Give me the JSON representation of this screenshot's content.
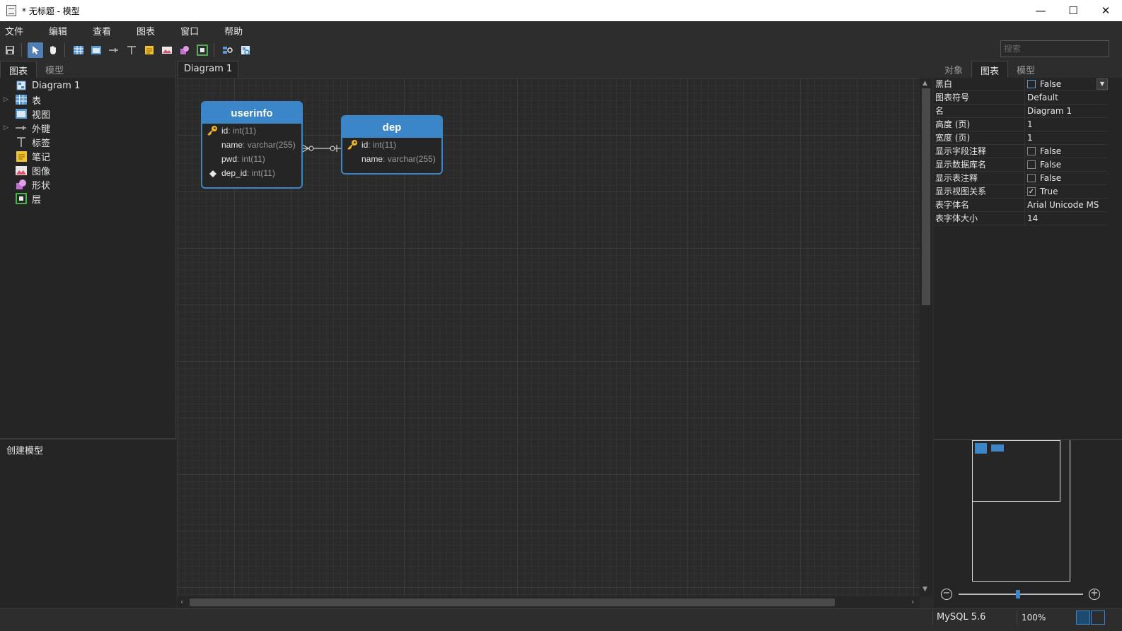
{
  "window": {
    "title": "* 无标题 - 模型",
    "controls": {
      "minimize": "—",
      "maximize": "☐",
      "close": "✕"
    }
  },
  "menu": [
    "文件",
    "编辑",
    "查看",
    "图表",
    "窗口",
    "帮助"
  ],
  "search": {
    "placeholder": "搜索"
  },
  "left_panel": {
    "tabs": [
      "图表",
      "模型"
    ],
    "tree": [
      {
        "label": "Diagram 1",
        "icon": "diagram-icon",
        "expandable": false
      },
      {
        "label": "表",
        "icon": "table-icon",
        "expandable": true
      },
      {
        "label": "视图",
        "icon": "view-icon",
        "expandable": false
      },
      {
        "label": "外键",
        "icon": "foreign-key-icon",
        "expandable": true
      },
      {
        "label": "标签",
        "icon": "label-icon",
        "expandable": false
      },
      {
        "label": "笔记",
        "icon": "note-icon",
        "expandable": false
      },
      {
        "label": "图像",
        "icon": "image-icon",
        "expandable": false
      },
      {
        "label": "形状",
        "icon": "shape-icon",
        "expandable": false
      },
      {
        "label": "层",
        "icon": "layer-icon",
        "expandable": false
      }
    ],
    "bottom_title": "创建模型"
  },
  "diagram_tab": "Diagram 1",
  "er_tables": [
    {
      "name": "userinfo",
      "fields": [
        {
          "name": "id",
          "type": ": int(11)",
          "icon": "key"
        },
        {
          "name": "name",
          "type": ": varchar(255)",
          "icon": ""
        },
        {
          "name": "pwd",
          "type": ": int(11)",
          "icon": ""
        },
        {
          "name": "dep_id",
          "type": ": int(11)",
          "icon": "diamond"
        }
      ]
    },
    {
      "name": "dep",
      "fields": [
        {
          "name": "id",
          "type": ": int(11)",
          "icon": "key"
        },
        {
          "name": "name",
          "type": ": varchar(255)",
          "icon": ""
        }
      ]
    }
  ],
  "right_panel": {
    "tabs": [
      "对象",
      "图表",
      "模型"
    ],
    "properties": [
      {
        "name": "黑白",
        "value": "False",
        "checkbox": "unchecked-blue",
        "dropdown": true
      },
      {
        "name": "图表符号",
        "value": "Default"
      },
      {
        "name": "名",
        "value": "Diagram 1"
      },
      {
        "name": "高度 (页)",
        "value": "1"
      },
      {
        "name": "宽度 (页)",
        "value": "1"
      },
      {
        "name": "显示字段注释",
        "value": "False",
        "checkbox": "unchecked"
      },
      {
        "name": "显示数据库名",
        "value": "False",
        "checkbox": "unchecked"
      },
      {
        "name": "显示表注释",
        "value": "False",
        "checkbox": "unchecked"
      },
      {
        "name": "显示视图关系",
        "value": "True",
        "checkbox": "checked"
      },
      {
        "name": "表字体名",
        "value": "Arial Unicode MS"
      },
      {
        "name": "表字体大小",
        "value": "14"
      }
    ],
    "zoom_slider_level": 0.5
  },
  "status": {
    "database": "MySQL 5.6",
    "zoom": "100%"
  },
  "colors": {
    "accent": "#3b86c9",
    "background": "#2b2b2b",
    "key": "#f0b429"
  }
}
